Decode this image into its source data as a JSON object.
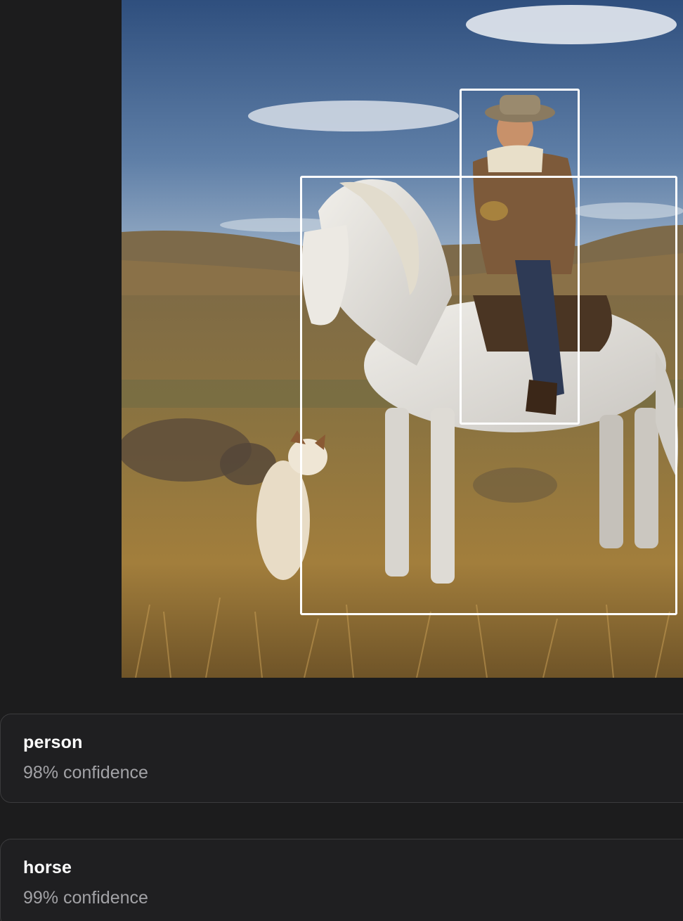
{
  "detection": {
    "photo_alt": "cowboy on a white horse with a dog in a grassy field"
  },
  "results": [
    {
      "label": "person",
      "confidence": "98% confidence"
    },
    {
      "label": "horse",
      "confidence": "99% confidence"
    }
  ],
  "colors": {
    "background": "#1c1c1d",
    "card_background": "#1f1f21",
    "card_border": "#3b3b3d",
    "label_text": "#ffffff",
    "confidence_text": "#a2a2a6",
    "bounding_box": "#ffffff"
  }
}
